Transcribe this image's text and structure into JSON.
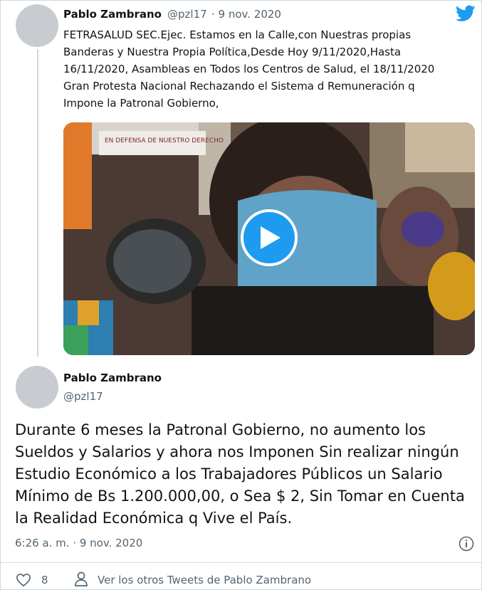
{
  "tweet": {
    "author_name": "Pablo Zambrano",
    "author_handle": "@pzl17",
    "date": "· 9 nov. 2020",
    "text": "FETRASALUD SEC.Ejec. Estamos en la Calle,con Nuestras propias\nBanderas y Nuestra Propia Política,Desde Hoy 9/11/2020,Hasta\n16/11/2020, Asambleas en Todos los Centros de Salud, el 18/11/2020\nGran Protesta Nacional Rechazando el Sistema d Remuneración q\nImpone la Patronal Gobierno,",
    "video_sign_text": "EN DEFENSA DE NUESTRO DERECHO"
  },
  "reply": {
    "author_name": "Pablo Zambrano",
    "author_handle": "@pzl17",
    "text": "Durante 6 meses la Patronal Gobierno, no aumento los Sueldos y Salarios y ahora nos Imponen Sin realizar ningún Estudio Económico a los Trabajadores Públicos un Salario Mínimo de Bs 1.200.000,00, o Sea $ 2, Sin Tomar en Cuenta la Realidad Económica q Vive el País.",
    "timestamp": "6:26 a. m. · 9 nov. 2020",
    "like_count": "8",
    "more_tweets_link": "Ver los otros Tweets de Pablo Zambrano"
  },
  "icons": {
    "brand": "twitter-bird-icon",
    "play": "play-icon",
    "info": "info-icon",
    "like": "heart-icon",
    "profile": "person-icon"
  },
  "colors": {
    "brand_blue": "#1d9bf0",
    "secondary_text": "#536471",
    "primary_text": "#0f1419"
  }
}
